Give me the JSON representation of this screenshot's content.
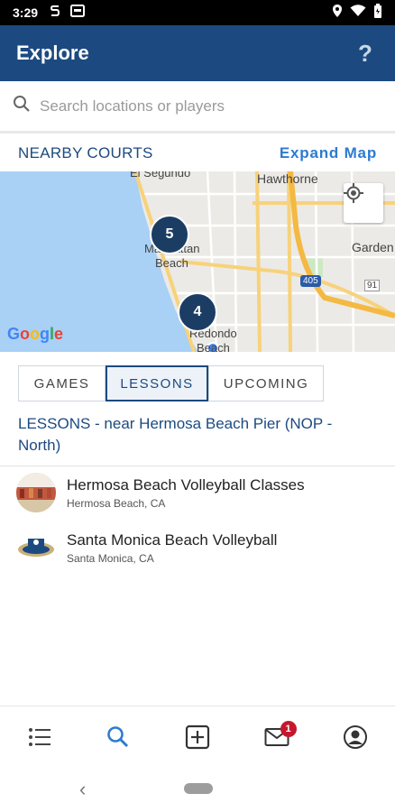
{
  "status_bar": {
    "time": "3:29"
  },
  "app_bar": {
    "title": "Explore",
    "help_label": "?"
  },
  "search": {
    "placeholder": "Search locations or players",
    "value": ""
  },
  "nearby": {
    "title": "NEARBY COURTS",
    "expand_label": "Expand Map"
  },
  "map": {
    "labels": {
      "el_segundo": "El Segundo",
      "hawthorne": "Hawthorne",
      "gardena": "Garden",
      "manhattan": "Manhattan",
      "beach": "Beach",
      "redondo": "Redondo",
      "redondo_beach": "Beach",
      "i405": "405",
      "r91": "91"
    },
    "clusters": [
      {
        "count": "5"
      },
      {
        "count": "4"
      }
    ],
    "attribution": "Google"
  },
  "tabs": [
    {
      "label": "GAMES",
      "active": false
    },
    {
      "label": "LESSONS",
      "active": true
    },
    {
      "label": "UPCOMING",
      "active": false
    }
  ],
  "lessons_heading": "LESSONS - near Hermosa Beach Pier (NOP - North)",
  "lessons": [
    {
      "title": "Hermosa Beach Volleyball Classes",
      "location": "Hermosa Beach, CA",
      "avatar_icon": "group-photo-icon"
    },
    {
      "title": "Santa Monica Beach Volleyball",
      "location": "Santa Monica, CA",
      "avatar_icon": "club-logo-icon"
    }
  ],
  "bottom_nav": {
    "items": [
      "list-icon",
      "search-icon",
      "add-box-icon",
      "mail-icon",
      "profile-icon"
    ],
    "active": "search-icon",
    "mail_badge": "1"
  },
  "colors": {
    "primary": "#1c4a80",
    "accent": "#2d7bd1",
    "badge": "#c6182d",
    "cluster": "#1c3d63"
  }
}
